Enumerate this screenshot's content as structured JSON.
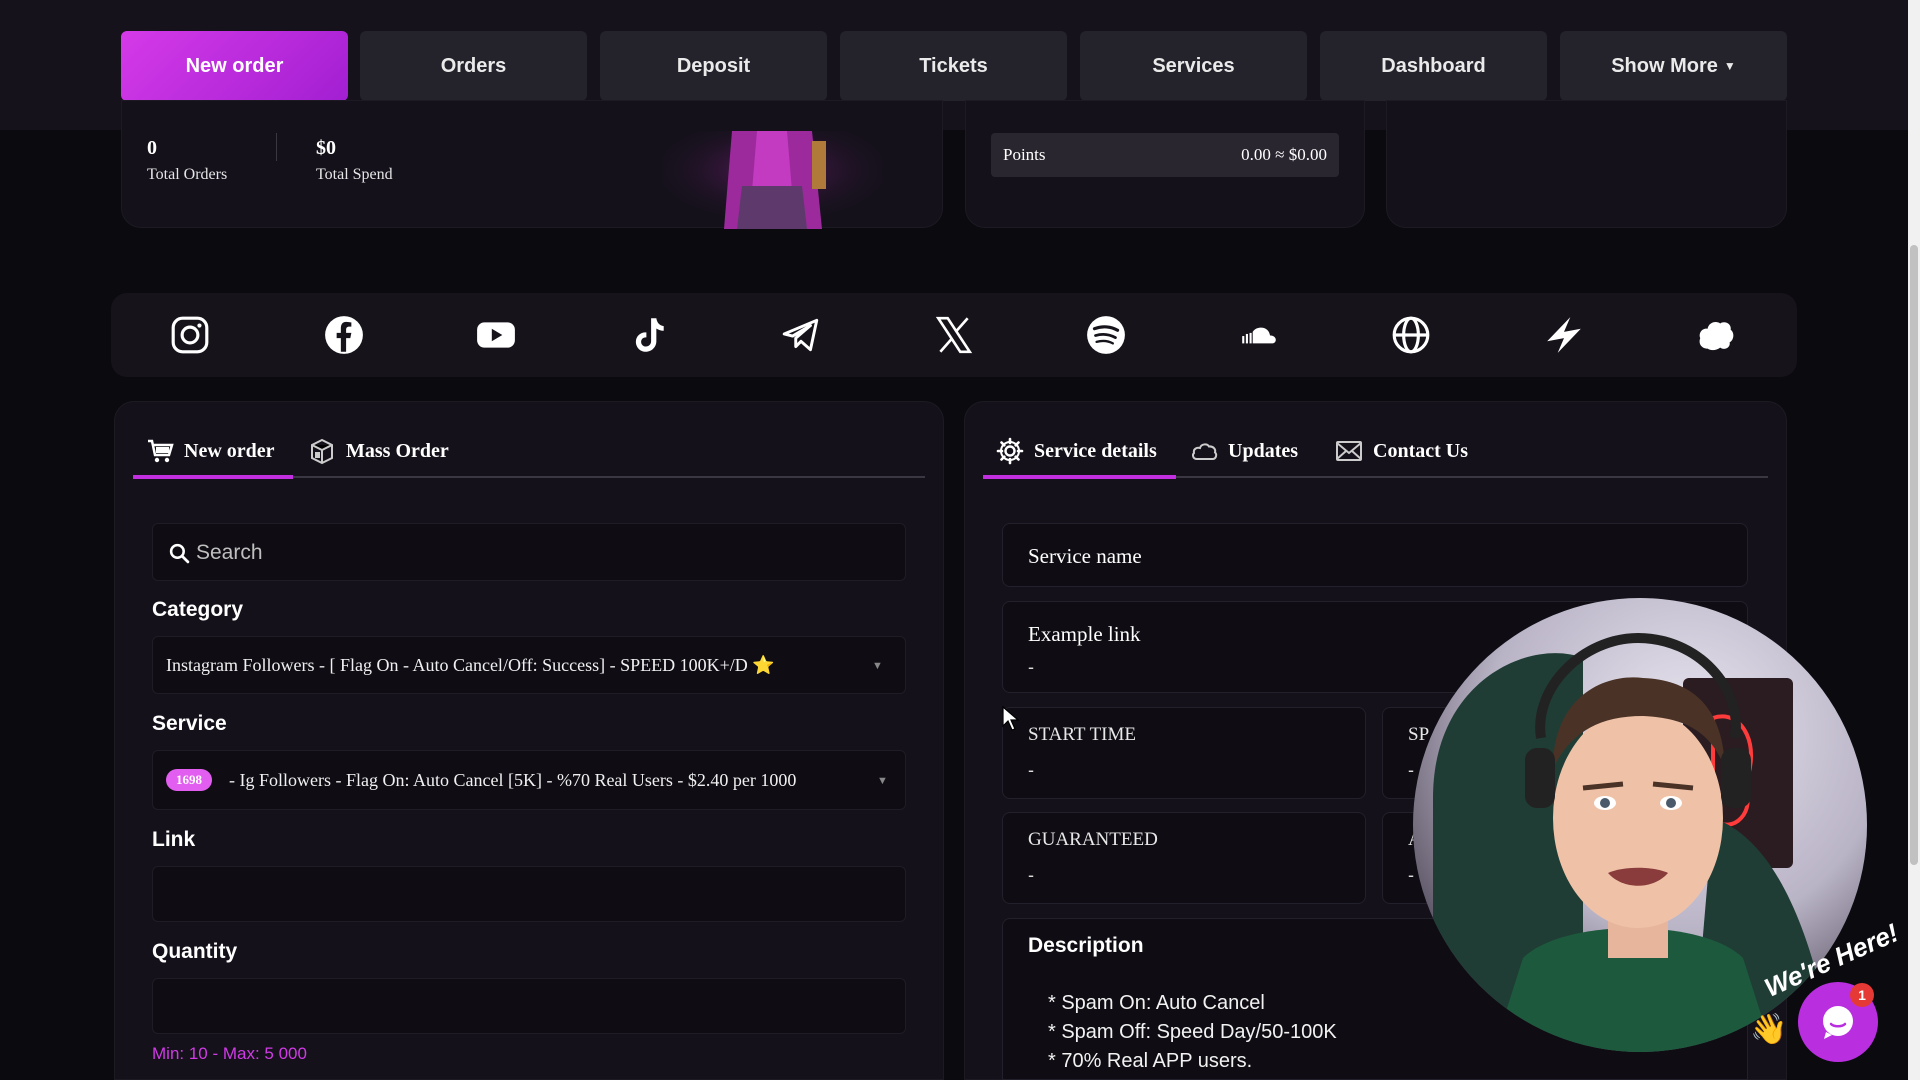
{
  "nav": {
    "items": [
      "New order",
      "Orders",
      "Deposit",
      "Tickets",
      "Services",
      "Dashboard",
      "Show More"
    ],
    "active": "New order"
  },
  "profile": {
    "total_orders_value": "0",
    "total_orders_label": "Total Orders",
    "total_spend_value": "$0",
    "total_spend_label": "Total Spend"
  },
  "points": {
    "label": "Points",
    "value": "0.00 ≈ $0.00"
  },
  "social_icons": [
    "instagram-icon",
    "facebook-icon",
    "youtube-icon",
    "tiktok-icon",
    "telegram-icon",
    "x-icon",
    "spotify-icon",
    "soundcloud-icon",
    "globe-icon",
    "spark-icon",
    "cloud-icon"
  ],
  "order_panel": {
    "tab_new_order": "New order",
    "tab_mass_order": "Mass Order",
    "search_placeholder": "Search",
    "category_label": "Category",
    "category_value": "Instagram Followers - [ Flag On - Auto Cancel/Off: Success] - SPEED 100K+/D ⭐",
    "service_label": "Service",
    "service_id": "1698",
    "service_value": "- Ig Followers - Flag On: Auto Cancel [5K] - %70 Real Users - $2.40 per 1000",
    "link_label": "Link",
    "link_value": "",
    "quantity_label": "Quantity",
    "quantity_value": "",
    "quantity_hint": "Min: 10 - Max: 5 000"
  },
  "details_panel": {
    "tab_service_details": "Service details",
    "tab_updates": "Updates",
    "tab_contact": "Contact Us",
    "service_name_label": "Service name",
    "example_link_label": "Example link",
    "example_link_value": "-",
    "start_time_label": "START TIME",
    "start_time_value": "-",
    "speed_label": "SP",
    "speed_value": "-",
    "guaranteed_label": "GUARANTEED",
    "guaranteed_value": "-",
    "avg_label": "A",
    "avg_value": "-",
    "description_label": "Description",
    "description_lines": [
      "* Spam On: Auto Cancel",
      "* Spam Off: Speed Day/50-100K",
      "* 70% Real APP users."
    ]
  },
  "chat": {
    "badge": "1",
    "banner": "We're Here!"
  },
  "colors": {
    "accent": "#c22fe0",
    "background": "#0b0a0f",
    "card": "#14111a"
  }
}
